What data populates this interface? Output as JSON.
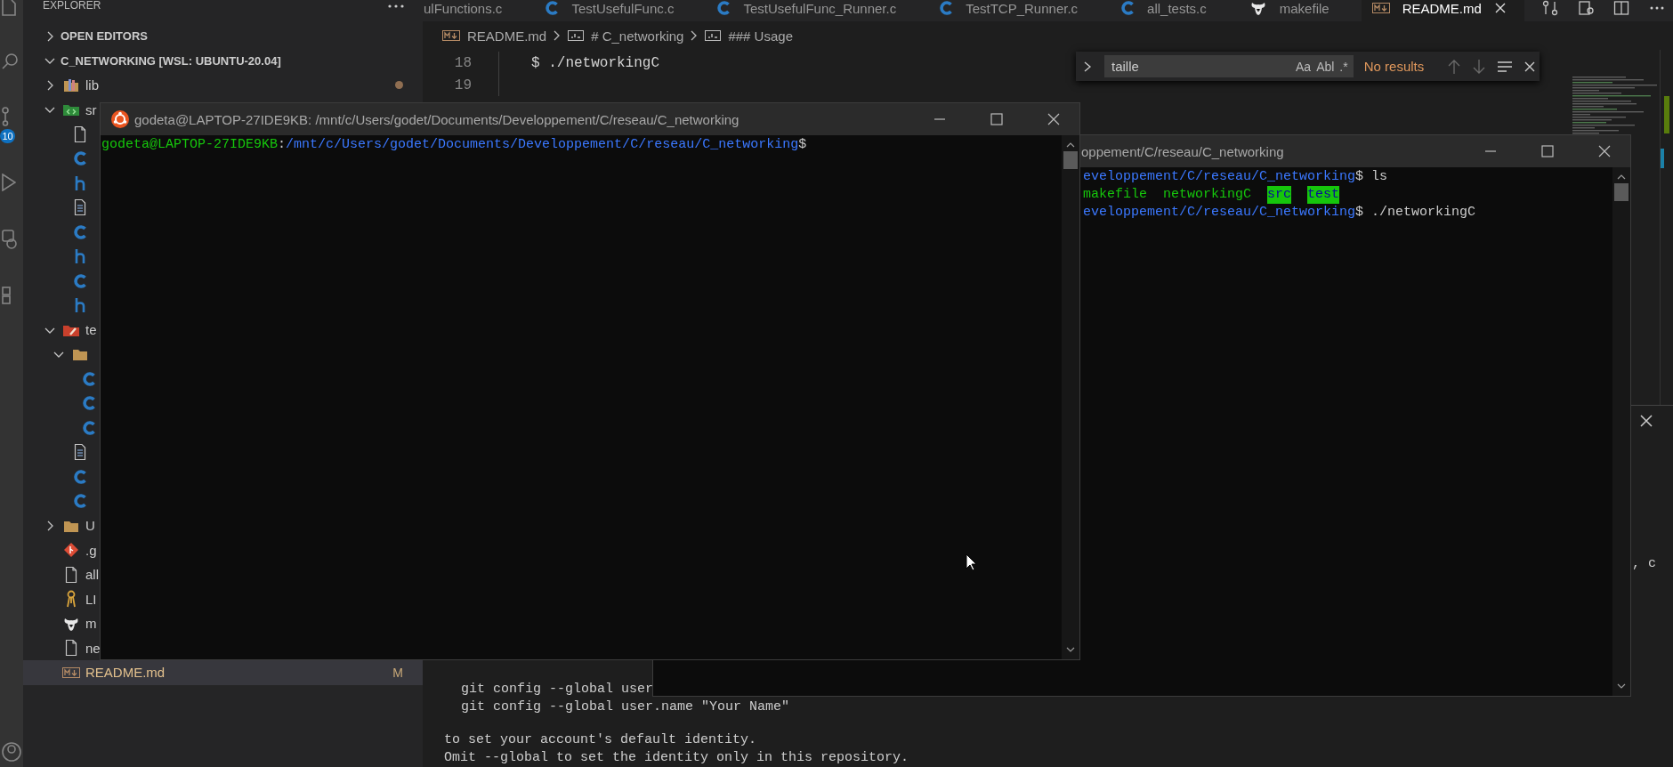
{
  "activity_bar": {
    "badge": "10"
  },
  "sidebar": {
    "title": "EXPLORER",
    "sections": [
      {
        "label": "OPEN EDITORS",
        "expanded": false
      },
      {
        "label": "C_NETWORKING [WSL: UBUNTU-20.04]",
        "expanded": true,
        "tree": [
          {
            "name": "lib",
            "kind": "folder-lib",
            "expanded": false,
            "selected": false,
            "modified": true
          },
          {
            "name": "sr",
            "kind": "folder-src",
            "expanded": true,
            "selected": false,
            "children": [
              {
                "kind": "file",
                "selected": false
              },
              {
                "kind": "c",
                "selected": false
              },
              {
                "kind": "h",
                "selected": false
              },
              {
                "kind": "text",
                "selected": false
              },
              {
                "kind": "c",
                "selected": false
              },
              {
                "kind": "h",
                "selected": false
              },
              {
                "kind": "c",
                "selected": false
              },
              {
                "kind": "h",
                "selected": false
              }
            ]
          },
          {
            "name": "te",
            "kind": "folder-test",
            "expanded": true,
            "selected": false,
            "children": [
              {
                "kind": "folder",
                "expanded": true,
                "selected": false,
                "children": [
                  {
                    "kind": "c",
                    "selected": false
                  },
                  {
                    "kind": "c",
                    "selected": false
                  },
                  {
                    "kind": "c",
                    "selected": false
                  }
                ]
              },
              {
                "kind": "text",
                "selected": false
              },
              {
                "kind": "c",
                "selected": false
              },
              {
                "kind": "c",
                "selected": false
              }
            ]
          },
          {
            "name": "U",
            "kind": "folder",
            "expanded": false,
            "selected": false
          },
          {
            "name": ".g",
            "kind": "git",
            "selected": false
          },
          {
            "name": "all",
            "kind": "file",
            "selected": false
          },
          {
            "name": "LI",
            "kind": "license",
            "selected": false
          },
          {
            "name": "m",
            "kind": "make",
            "selected": false
          },
          {
            "name": "ne",
            "kind": "file",
            "selected": false
          },
          {
            "name": "README.md",
            "kind": "markdown",
            "selected": true,
            "badge": "M"
          }
        ]
      }
    ]
  },
  "tabs": [
    {
      "label": "ulFunctions.c",
      "selected": false
    },
    {
      "label": "TestUsefulFunc.c",
      "kind": "c",
      "selected": false
    },
    {
      "label": "TestUsefulFunc_Runner.c",
      "kind": "c",
      "selected": false
    },
    {
      "label": "TestTCP_Runner.c",
      "kind": "c",
      "selected": false
    },
    {
      "label": "all_tests.c",
      "kind": "c",
      "selected": false
    },
    {
      "label": "makefile",
      "kind": "make",
      "selected": false
    },
    {
      "label": "README.md",
      "kind": "markdown",
      "selected": true
    }
  ],
  "breadcrumb": [
    {
      "label": "README.md",
      "kind": "markdown"
    },
    {
      "label": "# C_networking",
      "kind": "heading"
    },
    {
      "label": "### Usage",
      "kind": "heading"
    }
  ],
  "editor": {
    "lines": [
      {
        "number": "18",
        "text": "$ ./networkingC"
      },
      {
        "number": "19"
      }
    ]
  },
  "find_widget": {
    "value": "taille",
    "toggles": [
      "Aa",
      "Abl",
      ".*"
    ],
    "result": "No results"
  },
  "terminals": [
    {
      "title": "godeta@LAPTOP-27IDE9KB: /mnt/c/Users/godet/Documents/Developpement/C/reseau/C_networking",
      "lines": [
        {
          "kind": "prompt",
          "segments": [
            {
              "text": "godeta@LAPTOP-27IDE9KB",
              "kind": "user"
            },
            {
              "text": ":",
              "kind": "plain"
            },
            {
              "text": "/mnt/c/Users/godet/Documents/Developpement/C/reseau/C_networking",
              "kind": "path"
            },
            {
              "text": "$",
              "kind": "plain"
            }
          ]
        }
      ]
    },
    {
      "title": "oppement/C/reseau/C_networking",
      "lines": [
        {
          "kind": "prompt",
          "segments": [
            {
              "text": "eveloppement/C/reseau/C_networking",
              "kind": "path"
            },
            {
              "text": "$ ls",
              "kind": "plain"
            }
          ]
        },
        {
          "kind": "listing",
          "segments": [
            {
              "text": "makefile",
              "kind": "exec"
            },
            {
              "text": "networkingC",
              "kind": "exec"
            },
            {
              "text": "src",
              "kind": "dir"
            },
            {
              "text": "test",
              "kind": "dir"
            }
          ]
        },
        {
          "kind": "prompt",
          "segments": [
            {
              "text": "eveloppement/C/reseau/C_networking",
              "kind": "path"
            },
            {
              "text": "$ ./networkingC",
              "kind": "plain"
            }
          ]
        }
      ]
    }
  ],
  "panel": {
    "side_text": ", c",
    "lines": [
      {
        "text": "git config --global user",
        "kind": "command"
      },
      {
        "text": "git config --global user.name \"Your Name\"",
        "kind": "command"
      },
      {
        "text": "to set your account's default identity.",
        "kind": "message"
      },
      {
        "text": "Omit --global to set the identity only in this repository.",
        "kind": "message"
      }
    ]
  }
}
